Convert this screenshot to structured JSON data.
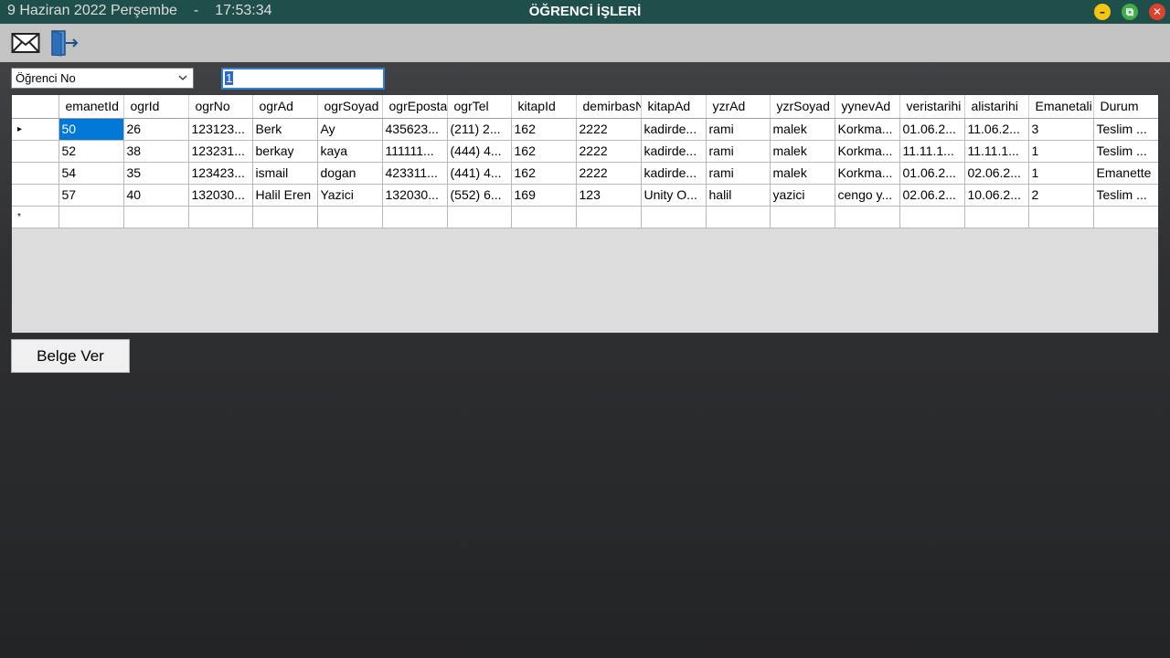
{
  "titlebar": {
    "date": "9 Haziran 2022 Perşembe",
    "separator": "-",
    "time": "17:53:34",
    "title": "ÖĞRENCİ İŞLERİ",
    "min_symbol": "–",
    "max_symbol": "⧉",
    "close_symbol": "✕"
  },
  "toolbar": {
    "icons": [
      "mail-icon",
      "exit-door-icon"
    ]
  },
  "filter": {
    "field_selected": "Öğrenci No",
    "search_value": "1"
  },
  "grid": {
    "columns": [
      "emanetId",
      "ogrId",
      "ogrNo",
      "ogrAd",
      "ogrSoyad",
      "ogrEposta",
      "ogrTel",
      "kitapId",
      "demirbasN",
      "kitapAd",
      "yzrAd",
      "yzrSoyad",
      "yynevAd",
      "veristarihi",
      "alistarihi",
      "Emanetali",
      "Durum"
    ],
    "rows": [
      [
        "50",
        "26",
        "123123...",
        "Berk",
        "Ay",
        "435623...",
        "(211) 2...",
        "162",
        "2222",
        "kadirde...",
        "rami",
        "malek",
        "Korkma...",
        "01.06.2...",
        "11.06.2...",
        "3",
        "Teslim ..."
      ],
      [
        "52",
        "38",
        "123231...",
        "berkay",
        "kaya",
        "111111...",
        "(444) 4...",
        "162",
        "2222",
        "kadirde...",
        "rami",
        "malek",
        "Korkma...",
        "11.11.1...",
        "11.11.1...",
        "1",
        "Teslim ..."
      ],
      [
        "54",
        "35",
        "123423...",
        "ismail",
        "dogan",
        "423311...",
        "(441) 4...",
        "162",
        "2222",
        "kadirde...",
        "rami",
        "malek",
        "Korkma...",
        "01.06.2...",
        "02.06.2...",
        "1",
        "Emanette"
      ],
      [
        "57",
        "40",
        "132030...",
        "Halil Eren",
        "Yazici",
        "132030...",
        "(552) 6...",
        "169",
        "123",
        "Unity O...",
        "halil",
        "yazici",
        "cengo y...",
        "02.06.2...",
        "10.06.2...",
        "2",
        "Teslim ..."
      ]
    ],
    "current_row_marker": "▸",
    "new_row_marker": "*"
  },
  "actions": {
    "belge_label": "Belge Ver"
  }
}
